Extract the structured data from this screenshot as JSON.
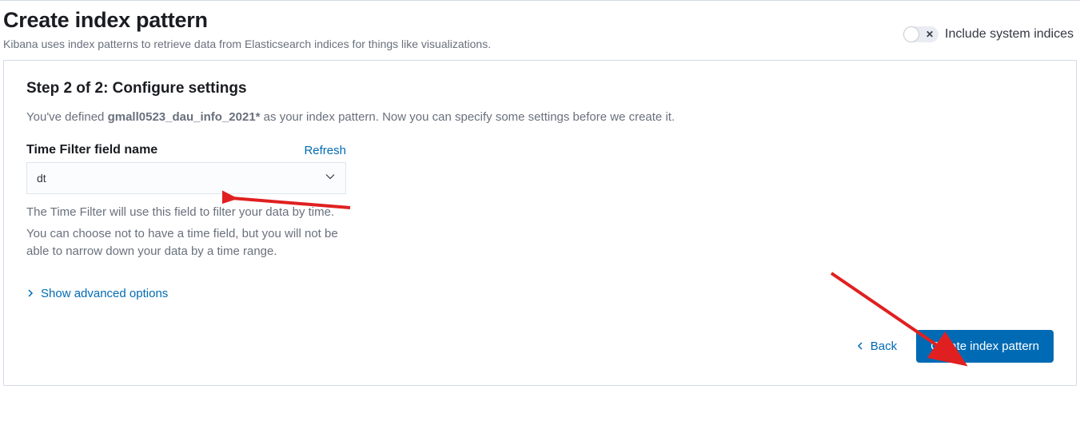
{
  "header": {
    "title": "Create index pattern",
    "subtitle": "Kibana uses index patterns to retrieve data from Elasticsearch indices for things like visualizations.",
    "include_system_indices_label": "Include system indices"
  },
  "panel": {
    "step_title": "Step 2 of 2: Configure settings",
    "step_desc_prefix": "You've defined ",
    "step_desc_pattern": "gmall0523_dau_info_2021*",
    "step_desc_suffix": " as your index pattern. Now you can specify some settings before we create it.",
    "form": {
      "label": "Time Filter field name",
      "refresh_label": "Refresh",
      "value": "dt",
      "help_line1": "The Time Filter will use this field to filter your data by time.",
      "help_line2": "You can choose not to have a time field, but you will not be able to narrow down your data by a time range."
    },
    "advanced_label": "Show advanced options",
    "footer": {
      "back_label": "Back",
      "submit_label": "Create index pattern"
    }
  }
}
